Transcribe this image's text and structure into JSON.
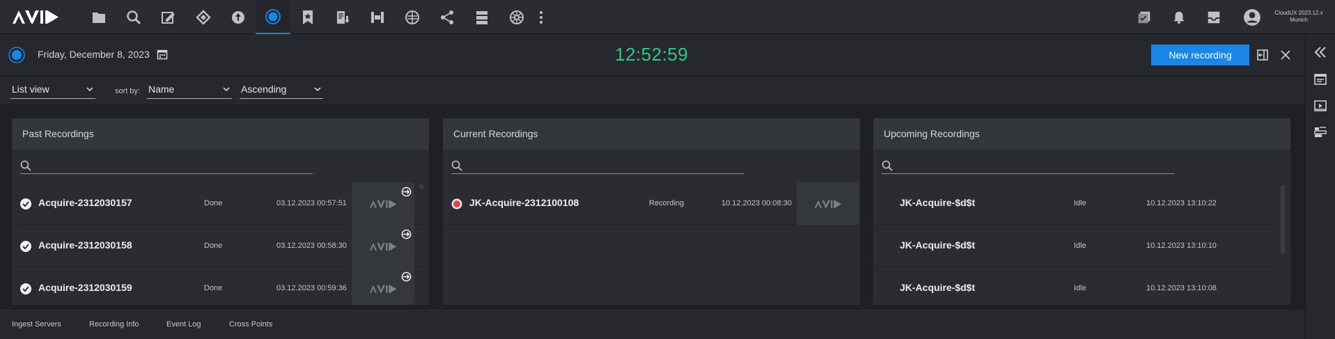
{
  "topbar": {
    "logo": "AVID",
    "icons": [
      "folder-icon",
      "search-icon",
      "edit-icon",
      "diamond-link-icon",
      "person-upload-icon",
      "capture-icon",
      "bookmark-star-icon",
      "document-download-icon",
      "film-icon",
      "network-globe-icon",
      "share-icon",
      "server-icon",
      "wheel-icon",
      "more-icon"
    ],
    "right_icons": [
      "checklist-icon",
      "bell-icon",
      "inbox-icon",
      "user-icon"
    ],
    "version": "CloudUX 2023.12.x",
    "location": "Munich"
  },
  "header": {
    "date": "Friday, December 8, 2023",
    "clock": "12:52:59",
    "new_button": "New recording"
  },
  "filters": {
    "view": "List view",
    "sort_label": "sort by:",
    "sort_field": "Name",
    "sort_order": "Ascending"
  },
  "panels": {
    "past": {
      "title": "Past Recordings",
      "rows": [
        {
          "name": "Acquire-2312030157",
          "status": "Done",
          "time": "03.12.2023 00:57:51"
        },
        {
          "name": "Acquire-2312030158",
          "status": "Done",
          "time": "03.12.2023 00:58:30"
        },
        {
          "name": "Acquire-2312030159",
          "status": "Done",
          "time": "03.12.2023 00:59:36"
        }
      ]
    },
    "current": {
      "title": "Current Recordings",
      "rows": [
        {
          "name": "JK-Acquire-2312100108",
          "status": "Recording",
          "time": "10.12.2023 00:08:30"
        }
      ]
    },
    "upcoming": {
      "title": "Upcoming Recordings",
      "rows": [
        {
          "name": "JK-Acquire-$d$t",
          "status": "Idle",
          "time": "10.12.2023 13:10:22"
        },
        {
          "name": "JK-Acquire-$d$t",
          "status": "Idle",
          "time": "10.12.2023 13:10:10"
        },
        {
          "name": "JK-Acquire-$d$t",
          "status": "Idle",
          "time": "10.12.2023 13:10:08"
        }
      ]
    }
  },
  "bottom_tabs": [
    "Ingest Servers",
    "Recording Info",
    "Event Log",
    "Cross Points"
  ],
  "colors": {
    "accent": "#1a86e8",
    "clock": "#2fc98a",
    "recording": "#e0463f"
  }
}
